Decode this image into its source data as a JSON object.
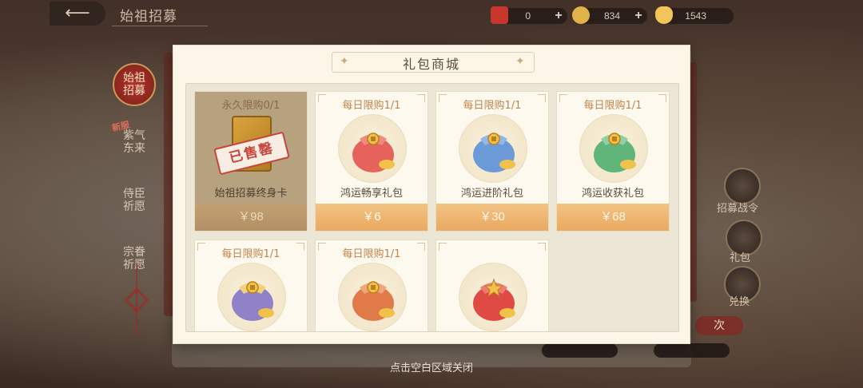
{
  "header": {
    "back_icon": "back-arrow-icon",
    "title": "始祖招募"
  },
  "currencies": [
    {
      "value": "0",
      "icon": "red-envelope-icon",
      "color": "#c8352c"
    },
    {
      "value": "834",
      "icon": "gold-ingot-icon",
      "color": "#e0b24a"
    },
    {
      "value": "1543",
      "icon": "gold-yuanbao-icon",
      "color": "#f1c55a"
    }
  ],
  "side_tabs": [
    {
      "label": "始祖招募",
      "active": true
    },
    {
      "label": "紫气东来",
      "badge": "新服"
    },
    {
      "label": "侍臣祈愿"
    },
    {
      "label": "宗眷祈愿"
    }
  ],
  "right_menu": [
    {
      "label": "招募战令"
    },
    {
      "label": "礼包"
    },
    {
      "label": "兑换"
    }
  ],
  "right_pill": "次",
  "modal": {
    "title": "礼包商城",
    "deco_left": "✦",
    "deco_right": "✦",
    "sold_stamp": "已售罄",
    "items": [
      {
        "limit": "永久限购0/1",
        "name": "始祖招募终身卡",
        "price": "￥98",
        "sold": true,
        "icon": "lifetime-card-icon"
      },
      {
        "limit": "每日限购1/1",
        "name": "鸿运畅享礼包",
        "price": "￥6",
        "icon": "red-gift-bag-icon",
        "color": "#e5635a"
      },
      {
        "limit": "每日限购1/1",
        "name": "鸿运进阶礼包",
        "price": "￥30",
        "icon": "blue-gift-bag-icon",
        "color": "#6b9ad8"
      },
      {
        "limit": "每日限购1/1",
        "name": "鸿运收获礼包",
        "price": "￥68",
        "icon": "green-gift-bag-icon",
        "color": "#5fb57a"
      },
      {
        "limit": "每日限购1/1",
        "name": "",
        "price": "",
        "icon": "purple-gift-bag-icon",
        "color": "#8f82c8"
      },
      {
        "limit": "每日限购1/1",
        "name": "",
        "price": "",
        "icon": "orange-gift-bag-icon",
        "color": "#e07a48"
      },
      {
        "limit": "",
        "name": "",
        "price": "",
        "icon": "red-star-gift-bag-icon",
        "color": "#e04a44"
      }
    ]
  },
  "close_hint": "点击空白区域关闭"
}
